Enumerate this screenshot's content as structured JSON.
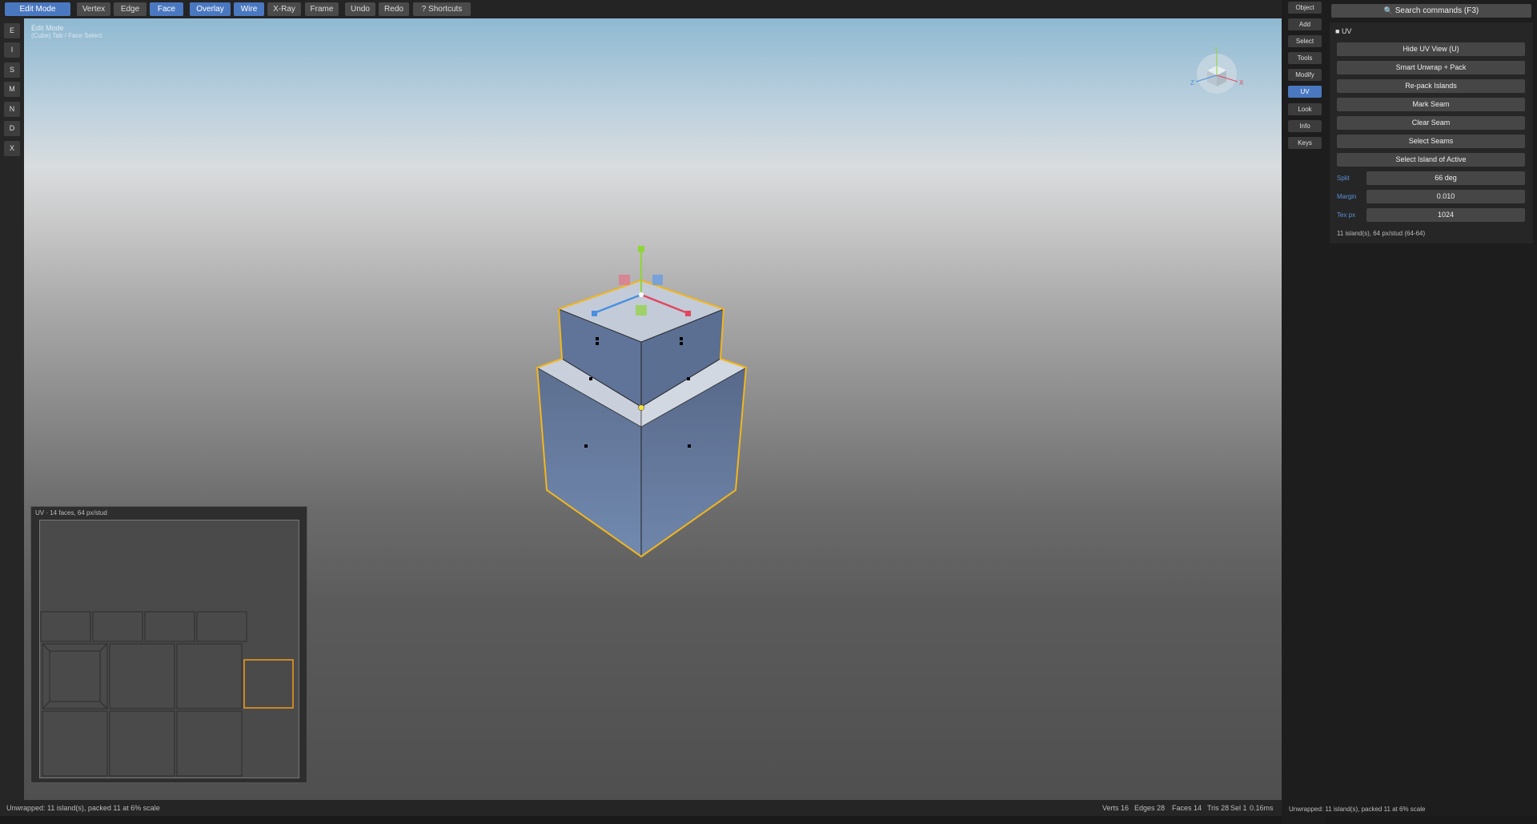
{
  "toolbar": {
    "mode": "Edit Mode",
    "vertex": "Vertex",
    "edge": "Edge",
    "face": "Face",
    "overlay": "Overlay",
    "wire": "Wire",
    "xray": "X-Ray",
    "frame": "Frame",
    "undo": "Undo",
    "redo": "Redo",
    "shortcuts": "?  Shortcuts"
  },
  "left_tools": [
    "E",
    "I",
    "S",
    "M",
    "N",
    "D",
    "X"
  ],
  "viewport": {
    "title": "Edit Mode",
    "subtitle": "(Cube) Tab / Face Select",
    "gizmo": {
      "y_label": "Y",
      "z_label": "Z",
      "x_label": "X"
    },
    "colors": {
      "selection": "#f2b61c",
      "face_fill": "#6c82a5",
      "bevel_fill": "#c8d0dc"
    }
  },
  "uv_panel": {
    "title": "UV  ·  14 faces, 64 px/stud"
  },
  "status_bar": {
    "message": "Unwrapped: 11 island(s), packed 11 at 6% scale",
    "verts": "Verts 16",
    "edges": "Edges 28",
    "faces": "Faces 14",
    "tris": "Tris 28",
    "sel": "Sel 1",
    "time": "0.16ms"
  },
  "right_tabs": {
    "object": "Object",
    "add": "Add",
    "select": "Select",
    "tools": "Tools",
    "modify": "Modify",
    "uv": "UV",
    "look": "Look",
    "info": "Info",
    "keys": "Keys"
  },
  "properties": {
    "search": "Search commands  (F3)",
    "section": "UV",
    "buttons": {
      "hide_uv": "Hide UV View  (U)",
      "smart_unwrap": "Smart Unwrap + Pack",
      "repack": "Re-pack Islands",
      "mark_seam": "Mark Seam",
      "clear_seam": "Clear Seam",
      "select_seams": "Select Seams",
      "select_island": "Select Island of Active"
    },
    "split_label": "Split",
    "split_value": "66 deg",
    "margin_label": "Margin",
    "margin_value": "0.010",
    "texpx_label": "Tex px",
    "texpx_value": "1024",
    "info": "11 island(s), 64 px/stud (64-64)"
  },
  "right_status": "Unwrapped: 11 island(s), packed 11 at 6% scale",
  "accent": "#4a78c0"
}
